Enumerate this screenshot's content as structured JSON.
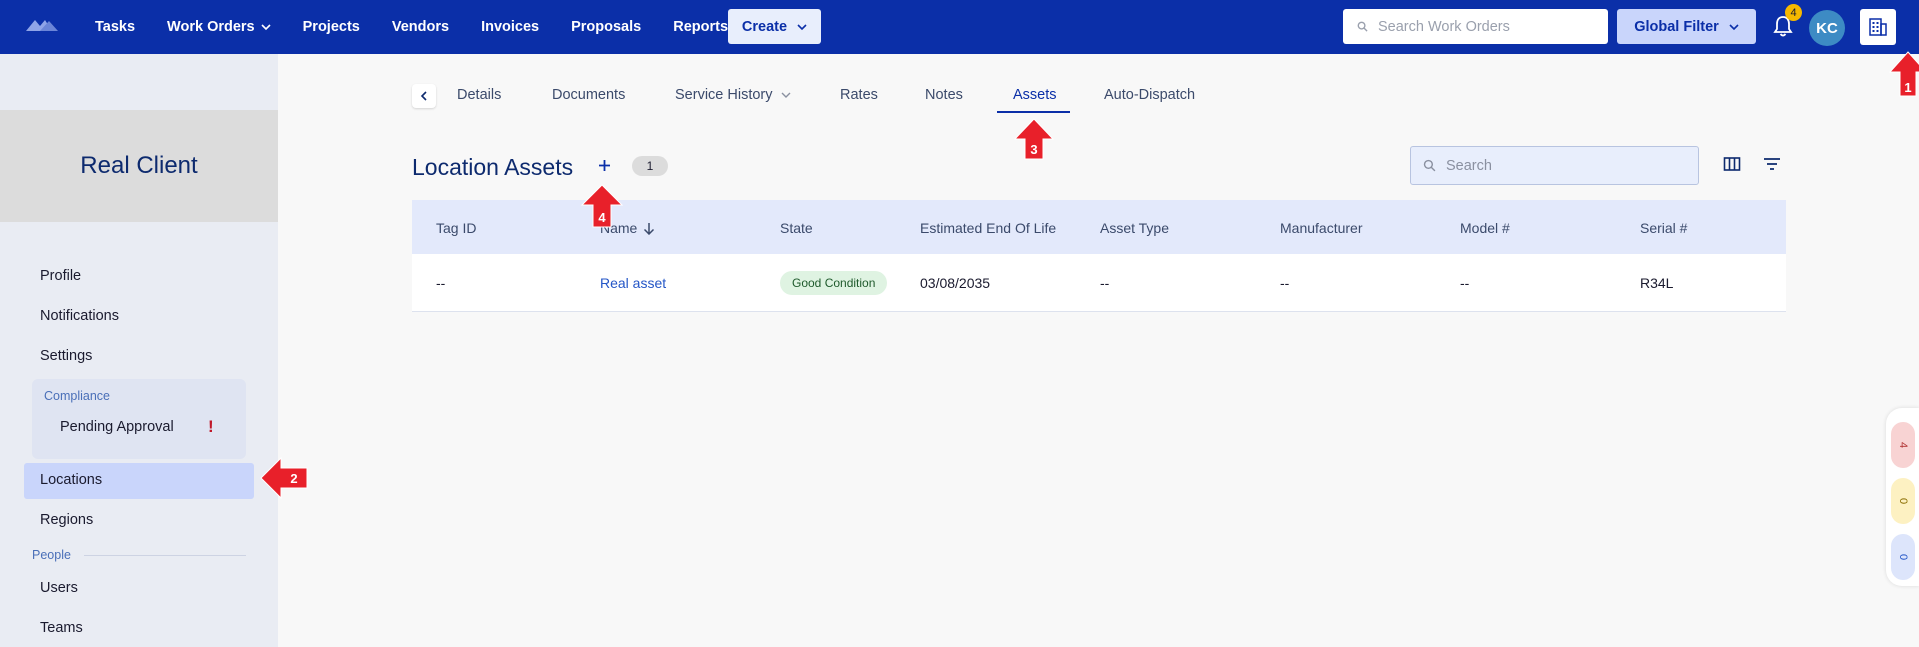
{
  "topbar": {
    "nav": [
      {
        "label": "Tasks",
        "dropdown": false
      },
      {
        "label": "Work Orders",
        "dropdown": true
      },
      {
        "label": "Projects",
        "dropdown": false
      },
      {
        "label": "Vendors",
        "dropdown": false
      },
      {
        "label": "Invoices",
        "dropdown": false
      },
      {
        "label": "Proposals",
        "dropdown": false
      },
      {
        "label": "Reports",
        "dropdown": false
      }
    ],
    "create_label": "Create",
    "search_placeholder": "Search Work Orders",
    "global_filter_label": "Global Filter",
    "notification_count": "4",
    "avatar_initials": "KC",
    "brand_color": "#0b2fa8"
  },
  "sidebar": {
    "client_name": "Real Client",
    "items": [
      {
        "label": "Profile"
      },
      {
        "label": "Notifications"
      },
      {
        "label": "Settings"
      }
    ],
    "compliance": {
      "label": "Compliance",
      "pending_label": "Pending Approval"
    },
    "locations_label": "Locations",
    "regions_label": "Regions",
    "people_label": "People",
    "users_label": "Users",
    "teams_label": "Teams"
  },
  "tabs": [
    {
      "label": "Details"
    },
    {
      "label": "Documents"
    },
    {
      "label": "Service History"
    },
    {
      "label": "Rates"
    },
    {
      "label": "Notes"
    },
    {
      "label": "Assets"
    },
    {
      "label": "Auto-Dispatch"
    }
  ],
  "active_tab": "Assets",
  "main": {
    "title": "Location Assets",
    "count": "1",
    "search_placeholder": "Search",
    "columns": [
      "Tag ID",
      "Name",
      "State",
      "Estimated End Of Life",
      "Asset Type",
      "Manufacturer",
      "Model #",
      "Serial #"
    ],
    "rows": [
      {
        "tag_id": "--",
        "name": "Real asset",
        "state": "Good Condition",
        "end_of_life": "03/08/2035",
        "asset_type": "--",
        "manufacturer": "--",
        "model": "--",
        "serial": "R34L"
      }
    ]
  },
  "side_pills": [
    {
      "value": "4",
      "color": "#f8d3d3"
    },
    {
      "value": "0",
      "color": "#fdf1c2"
    },
    {
      "value": "0",
      "color": "#dde5fb"
    }
  ],
  "annotations": [
    "1",
    "2",
    "3",
    "4"
  ]
}
